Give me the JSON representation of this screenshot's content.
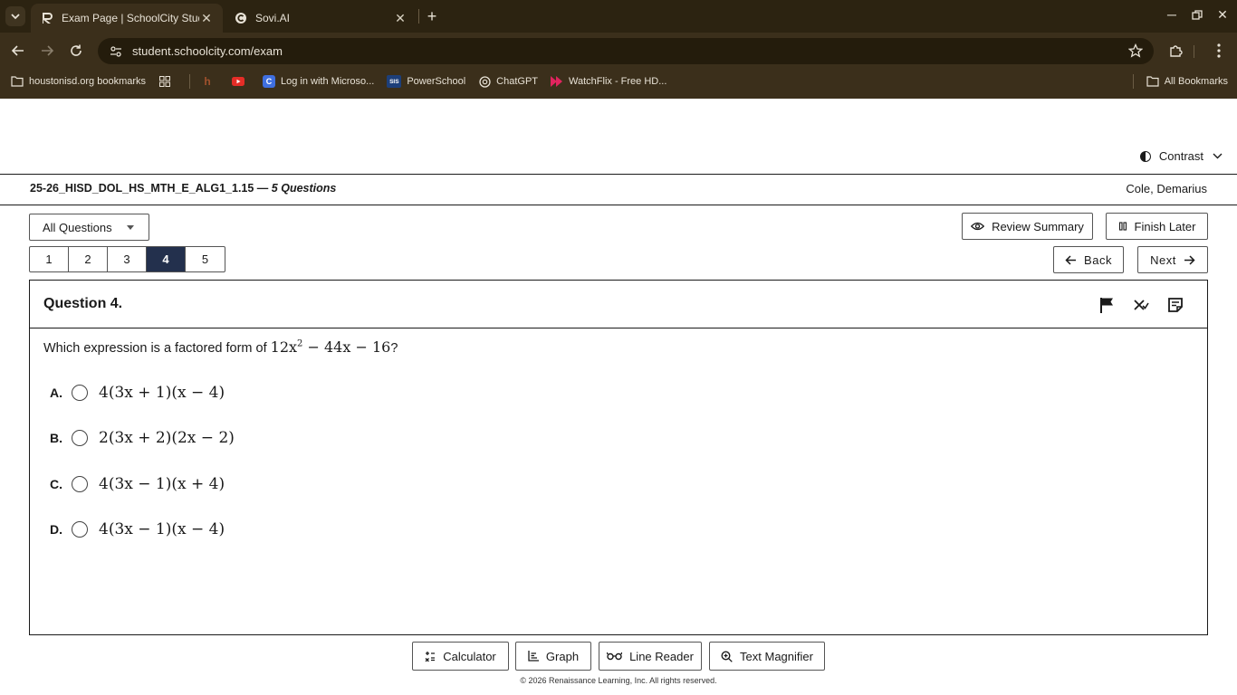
{
  "browser": {
    "tabs": [
      {
        "title": "Exam Page | SchoolCity Studen",
        "active": true,
        "favicon": "schoolcity-icon"
      },
      {
        "title": "Sovi.AI",
        "active": false,
        "favicon": "sovi-icon"
      }
    ],
    "url": "student.schoolcity.com/exam",
    "bookmarks": [
      {
        "label": "houstonisd.org bookmarks",
        "icon": "folder-icon"
      },
      {
        "label": "Log in with Microso...",
        "icon": "c-icon"
      },
      {
        "label": "PowerSchool",
        "icon": "sis-icon"
      },
      {
        "label": "ChatGPT",
        "icon": "chatgpt-icon"
      },
      {
        "label": "WatchFlix - Free HD...",
        "icon": "watchflix-icon"
      }
    ],
    "all_bookmarks": "All Bookmarks",
    "sis_text": "SIS"
  },
  "page": {
    "contrast_label": "Contrast",
    "exam_code": "25-26_HISD_DOL_HS_MTH_E_ALG1_1.15 —",
    "question_count": "5 Questions",
    "student_name": "Cole, Demarius",
    "filter_label": "All Questions",
    "question_numbers": [
      "1",
      "2",
      "3",
      "4",
      "5"
    ],
    "current_question": "4",
    "review_summary": "Review Summary",
    "finish_later": "Finish Later",
    "back": "Back",
    "next": "Next"
  },
  "question": {
    "title": "Question 4.",
    "stem_text": "Which expression is a factored form of",
    "stem_math_a": "12x",
    "stem_math_exp": "2",
    "stem_math_b": " − 44x − 16",
    "stem_end": "?",
    "options": [
      {
        "letter": "A.",
        "expr": "4(3x + 1)(x − 4)"
      },
      {
        "letter": "B.",
        "expr": "2(3x + 2)(2x − 2)"
      },
      {
        "letter": "C.",
        "expr": "4(3x − 1)(x + 4)"
      },
      {
        "letter": "D.",
        "expr": "4(3x − 1)(x − 4)"
      }
    ]
  },
  "tools": {
    "calculator": "Calculator",
    "graph": "Graph",
    "line_reader": "Line Reader",
    "text_magnifier": "Text Magnifier"
  },
  "footer": "© 2026 Renaissance Learning, Inc. All rights reserved.",
  "colors": {
    "chrome_bg": "#3b2f1b",
    "tabstrip_bg": "#2c2311",
    "current_q_bg": "#23304d"
  }
}
